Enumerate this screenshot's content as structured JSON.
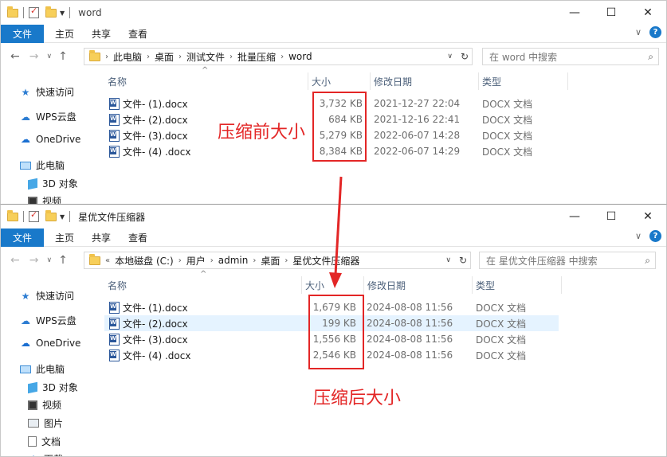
{
  "window1": {
    "title": "word",
    "ribbon": {
      "file": "文件",
      "home": "主页",
      "share": "共享",
      "view": "查看"
    },
    "breadcrumb": [
      "此电脑",
      "桌面",
      "测试文件",
      "批量压缩",
      "word"
    ],
    "search_placeholder": "在 word 中搜索",
    "nav": [
      "快速访问",
      "WPS云盘",
      "OneDrive",
      "此电脑",
      "3D 对象",
      "视频"
    ],
    "columns": {
      "name": "名称",
      "size": "大小",
      "modified": "修改日期",
      "type": "类型"
    },
    "files": [
      {
        "name": "文件- (1).docx",
        "size": "3,732 KB",
        "date": "2021-12-27 22:04",
        "type": "DOCX 文档"
      },
      {
        "name": "文件- (2).docx",
        "size": "684 KB",
        "date": "2021-12-16 22:41",
        "type": "DOCX 文档"
      },
      {
        "name": "文件- (3).docx",
        "size": "5,279 KB",
        "date": "2022-06-07 14:28",
        "type": "DOCX 文档"
      },
      {
        "name": "文件- (4) .docx",
        "size": "8,384 KB",
        "date": "2022-06-07 14:29",
        "type": "DOCX 文档"
      }
    ],
    "annotation": "压缩前大小"
  },
  "window2": {
    "title": "星优文件压缩器",
    "ribbon": {
      "file": "文件",
      "home": "主页",
      "share": "共享",
      "view": "查看"
    },
    "breadcrumb_prefix": "«",
    "breadcrumb": [
      "本地磁盘 (C:)",
      "用户",
      "admin",
      "桌面",
      "星优文件压缩器"
    ],
    "search_placeholder": "在 星优文件压缩器 中搜索",
    "nav": [
      "快速访问",
      "WPS云盘",
      "OneDrive",
      "此电脑",
      "3D 对象",
      "视频",
      "图片",
      "文档",
      "下载"
    ],
    "columns": {
      "name": "名称",
      "size": "大小",
      "modified": "修改日期",
      "type": "类型"
    },
    "files": [
      {
        "name": "文件- (1).docx",
        "size": "1,679 KB",
        "date": "2024-08-08 11:56",
        "type": "DOCX 文档"
      },
      {
        "name": "文件- (2).docx",
        "size": "199 KB",
        "date": "2024-08-08 11:56",
        "type": "DOCX 文档"
      },
      {
        "name": "文件- (3).docx",
        "size": "1,556 KB",
        "date": "2024-08-08 11:56",
        "type": "DOCX 文档"
      },
      {
        "name": "文件- (4) .docx",
        "size": "2,546 KB",
        "date": "2024-08-08 11:56",
        "type": "DOCX 文档"
      }
    ],
    "selected_row": 1,
    "annotation": "压缩后大小"
  },
  "colors": {
    "accent": "#1979ca",
    "annotation": "#e32626"
  }
}
